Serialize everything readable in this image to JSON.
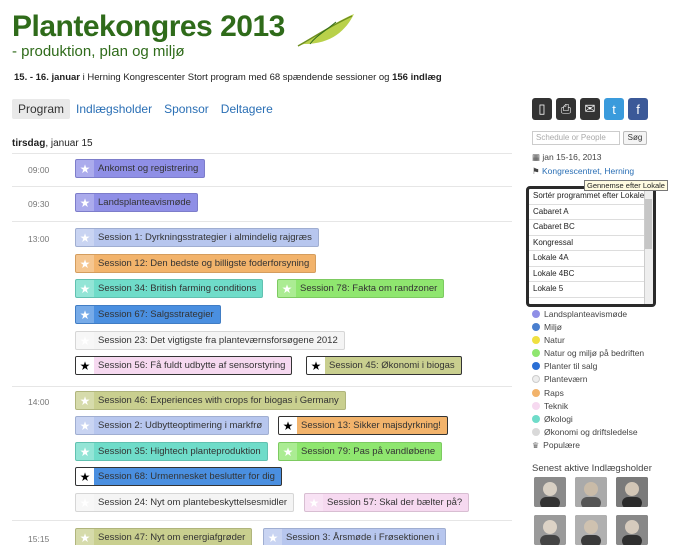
{
  "header": {
    "title": "Plantekongres 2013",
    "subtitle": "- produktion, plan og miljø",
    "intro_dates": "15. - 16. januar",
    "intro_middle": " i Herning Kongrescenter  Stort program med 68 spændende sessioner og ",
    "intro_count": "156 indlæg"
  },
  "nav": {
    "tabs": [
      {
        "label": "Program"
      },
      {
        "label": "Indlægsholder"
      },
      {
        "label": "Sponsor"
      },
      {
        "label": "Deltagere"
      }
    ]
  },
  "schedule": {
    "day_label": "tirsdag",
    "day_date": ", januar 15",
    "times": [
      "09:00",
      "09:30",
      "13:00",
      "14:00",
      "15:15"
    ],
    "sessions": [
      {
        "label": "Ankomst og registrering",
        "color": "#8f8fe6"
      },
      {
        "label": "Landsplanteavismøde",
        "color": "#8f8fe6"
      },
      {
        "label": "Session 1: Dyrkningsstrategier i almindelig rajgræs",
        "color": "#b7c6ee"
      },
      {
        "label": "Session 12: Den bedste og billigste foderforsyning",
        "color": "#f2b36b"
      },
      {
        "label": "Session 34: British farming conditions",
        "color": "#6fdcc9"
      },
      {
        "label": "Session 78: Fakta om randzoner",
        "color": "#8fe66f"
      },
      {
        "label": "Session 67: Salgsstrategier",
        "color": "#4a8fe0"
      },
      {
        "label": "Session 23: Det vigtigste fra planteværnsforsøgene 2012",
        "color": "#f4f4f4"
      },
      {
        "label": "Session 56: Få fuldt udbytte af sensorstyring",
        "color": "#f6d9f0"
      },
      {
        "label": "Session 45: Økonomi i biogas",
        "color": "#c9cf8f"
      },
      {
        "label": "Session 46: Experiences with crops for biogas i Germany",
        "color": "#c9cf8f"
      },
      {
        "label": "Session 2: Udbytteoptimering i markfrø",
        "color": "#b7c6ee"
      },
      {
        "label": "Session 13: Sikker majsdyrkning!",
        "color": "#f2b36b"
      },
      {
        "label": "Session 35: Hightech planteproduktion",
        "color": "#6fdcc9"
      },
      {
        "label": "Session 79: Pas på vandløbene",
        "color": "#8fe66f"
      },
      {
        "label": "Session 68: Urmennesket beslutter for dig",
        "color": "#4a8fe0"
      },
      {
        "label": "Session 24: Nyt om plantebeskyttelsesmidler",
        "color": "#f4f4f4"
      },
      {
        "label": "Session 57: Skal der bælter på?",
        "color": "#f6d9f0"
      },
      {
        "label": "Session 47: Nyt om energiafgrøder",
        "color": "#c9cf8f"
      },
      {
        "label": "Session 3: Årsmøde i Frøsektionen i",
        "color": "#b7c6ee"
      }
    ]
  },
  "sidebar": {
    "icons": [
      {
        "name": "mobile-icon",
        "glyph": "▯",
        "bg": "#333333"
      },
      {
        "name": "print-icon",
        "glyph": "⎙",
        "bg": "#333333"
      },
      {
        "name": "email-icon",
        "glyph": "✉",
        "bg": "#333333"
      },
      {
        "name": "twitter-icon",
        "glyph": "t",
        "bg": "#3a9bdc"
      },
      {
        "name": "facebook-icon",
        "glyph": "f",
        "bg": "#3b5998"
      }
    ],
    "search_placeholder": "Schedule or People",
    "search_button": "Søg",
    "date_range": "jan 15-16, 2013",
    "location": "Kongrescentret, Herning",
    "tooltip": "Gennemse efter Lokale",
    "dropdown_items": [
      "Sortér programmet efter Lokale",
      "Cabaret A",
      "Cabaret BC",
      "Kongressal",
      "Lokale 4A",
      "Lokale 4BC",
      "Lokale 5"
    ],
    "legend": [
      {
        "label": "Landsplanteavismøde",
        "color": "#8f8fe6"
      },
      {
        "label": "Miljø",
        "color": "#4a7fcf"
      },
      {
        "label": "Natur",
        "color": "#f0e040"
      },
      {
        "label": "Natur og miljø på bedriften",
        "color": "#8fe66f"
      },
      {
        "label": "Planter til salg",
        "color": "#2a6fd5"
      },
      {
        "label": "Planteværn",
        "color": "#eeeeee"
      },
      {
        "label": "Raps",
        "color": "#f2b36b"
      },
      {
        "label": "Teknik",
        "color": "#f6d9f0"
      },
      {
        "label": "Økologi",
        "color": "#6fdcc9"
      },
      {
        "label": "Økonomi og driftsledelse",
        "color": "#d9d9d9"
      },
      {
        "label": "Populære",
        "color": "#777777"
      }
    ],
    "active_title": "Senest aktive Indlægsholder"
  }
}
